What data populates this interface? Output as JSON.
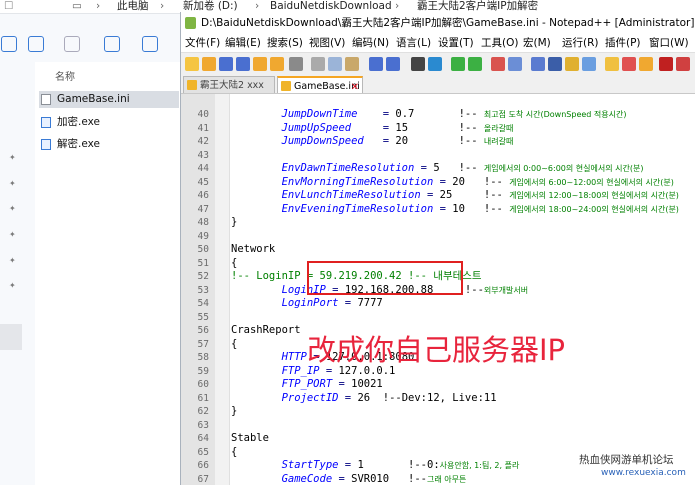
{
  "explorer": {
    "breadcrumb": [
      "此电脑",
      "新加卷 (D:)",
      "BaiduNetdiskDownload",
      "霸王大陆2客户端IP加解密"
    ],
    "column_name": "名称",
    "files": [
      {
        "name": "GameBase.ini",
        "type": "ini",
        "selected": true
      },
      {
        "name": "加密.exe",
        "type": "exe",
        "selected": false
      },
      {
        "name": "解密.exe",
        "type": "exe",
        "selected": false
      }
    ]
  },
  "notepad": {
    "title": "D:\\BaiduNetdiskDownload\\霸王大陆2客户端IP加解密\\GameBase.ini - Notepad++ [Administrator]",
    "menu": [
      "文件(F)",
      "编辑(E)",
      "搜索(S)",
      "视图(V)",
      "编码(N)",
      "语言(L)",
      "设置(T)",
      "工具(O)",
      "宏(M)",
      "运行(R)",
      "插件(P)",
      "窗口(W)"
    ],
    "tabs": [
      {
        "label": "霸王大陆2 xxx",
        "active": false
      },
      {
        "label": "GameBase.ini",
        "active": true
      }
    ],
    "lines": [
      {
        "n": "40",
        "indent": "        ",
        "key": "JumpDownTime",
        "sep": "    = ",
        "val": "0.7",
        "comment_pre": "       !-- ",
        "kr": "최고점 도착 시간",
        "comment_post": "(DownSpeed 적용시간)"
      },
      {
        "n": "41",
        "indent": "        ",
        "key": "JumpUpSpeed",
        "sep": "     = ",
        "val": "15",
        "comment_pre": "        !-- ",
        "kr": "올라갈때",
        "comment_post": ""
      },
      {
        "n": "42",
        "indent": "        ",
        "key": "JumpDownSpeed",
        "sep": "   = ",
        "val": "20",
        "comment_pre": "        !-- ",
        "kr": "내려갈때",
        "comment_post": ""
      },
      {
        "n": "43",
        "text": ""
      },
      {
        "n": "44",
        "indent": "        ",
        "key": "EnvDawnTimeResolution",
        "sep": " = ",
        "val": "5",
        "comment_pre": "   !-- ",
        "kr": "게임에서의",
        "comment_post": " 0:00~6:00의 현실에서의 시간(분)"
      },
      {
        "n": "45",
        "indent": "        ",
        "key": "EnvMorningTimeResolution",
        "sep": " = ",
        "val": "20",
        "comment_pre": "   !-- ",
        "kr": "게임에서의",
        "comment_post": " 6:00~12:00의 현실에서의 시간(분)"
      },
      {
        "n": "46",
        "indent": "        ",
        "key": "EnvLunchTimeResolution",
        "sep": " = ",
        "val": "25",
        "comment_pre": "     !-- ",
        "kr": "게임에서의",
        "comment_post": " 12:00~18:00의 현실에서의 시간(분)"
      },
      {
        "n": "47",
        "indent": "        ",
        "key": "EnvEveningTimeResolution",
        "sep": " = ",
        "val": "10",
        "comment_pre": "   !-- ",
        "kr": "게임에서의",
        "comment_post": " 18:00~24:00의 현실에서의 시간(분)"
      },
      {
        "n": "48",
        "text": "}"
      },
      {
        "n": "49",
        "text": ""
      },
      {
        "n": "50",
        "text": "Network"
      },
      {
        "n": "51",
        "text": "{"
      },
      {
        "n": "52",
        "comment_line": "!-- LoginIP = 59.219.200.42 !-- 내부테스트"
      },
      {
        "n": "53",
        "indent": "        ",
        "key": "LoginIP",
        "sep": " = ",
        "val": "192.168.200.88",
        "comment_pre": "     !--",
        "kr": "외부개발서버",
        "comment_post": ""
      },
      {
        "n": "54",
        "indent": "        ",
        "key": "LoginPort",
        "sep": " = ",
        "val": "7777",
        "comment_pre": "",
        "kr": "",
        "comment_post": ""
      },
      {
        "n": "55",
        "text": ""
      },
      {
        "n": "56",
        "text": "CrashReport"
      },
      {
        "n": "57",
        "text": "{"
      },
      {
        "n": "58",
        "indent": "        ",
        "key": "HTTP",
        "sep": " = ",
        "val": "127.0.0.1:8080",
        "comment_pre": "",
        "kr": "",
        "comment_post": ""
      },
      {
        "n": "59",
        "indent": "        ",
        "key": "FTP_IP",
        "sep": " = ",
        "val": "127.0.0.1",
        "comment_pre": "",
        "kr": "",
        "comment_post": ""
      },
      {
        "n": "60",
        "indent": "        ",
        "key": "FTP_PORT",
        "sep": " = ",
        "val": "10021",
        "comment_pre": "",
        "kr": "",
        "comment_post": ""
      },
      {
        "n": "61",
        "indent": "        ",
        "key": "ProjectID",
        "sep": " = ",
        "val": "26",
        "comment_pre": "  !--Dev:12, Live:11",
        "kr": "",
        "comment_post": ""
      },
      {
        "n": "62",
        "text": "}"
      },
      {
        "n": "63",
        "text": ""
      },
      {
        "n": "64",
        "text": "Stable"
      },
      {
        "n": "65",
        "text": "{"
      },
      {
        "n": "66",
        "indent": "        ",
        "key": "StartType",
        "sep": " = ",
        "val": "1",
        "comment_pre": "       !--0:",
        "kr": "사용안함",
        "comment_post": ", 1:팀, 2, 플라"
      },
      {
        "n": "67",
        "indent": "        ",
        "key": "GameCode",
        "sep": " = ",
        "val": "SVR010",
        "comment_pre": "   !--",
        "kr": "그래 아무튼",
        "comment_post": ""
      }
    ]
  },
  "annotation": "改成你自己服务器IP",
  "watermark": {
    "line1": "热血侠网游单机论坛",
    "line2": "www.rexuexia.com"
  },
  "colors": {
    "key": "#0000ff",
    "comment": "#008000",
    "annotation": "#e8243c",
    "box": "#e02020"
  }
}
